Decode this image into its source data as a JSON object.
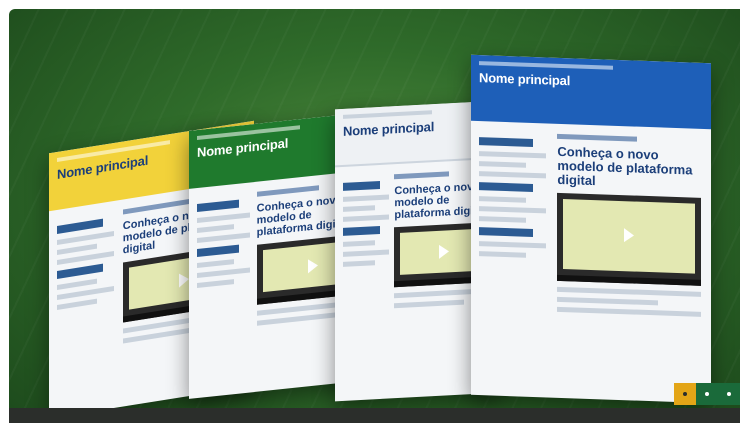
{
  "panels": [
    {
      "theme": "yellow",
      "title": "Nome principal",
      "feature": "Conheça o novo modelo de plataforma digital"
    },
    {
      "theme": "green",
      "title": "Nome principal",
      "feature": "Conheça o novo modelo de plataforma digital"
    },
    {
      "theme": "white",
      "title": "Nome principal",
      "feature": "Conheça o novo modelo de plataforma digital"
    },
    {
      "theme": "blue",
      "title": "Nome principal",
      "feature": "Conheça o novo modelo de plataforma digital"
    }
  ],
  "slider": {
    "total_slides": 3,
    "active_index": 0
  },
  "colors": {
    "yellow": "#f2d23a",
    "green": "#1f7a2d",
    "blue": "#1e5fb8",
    "white": "#eef1f4",
    "accent": "#e3a517"
  }
}
